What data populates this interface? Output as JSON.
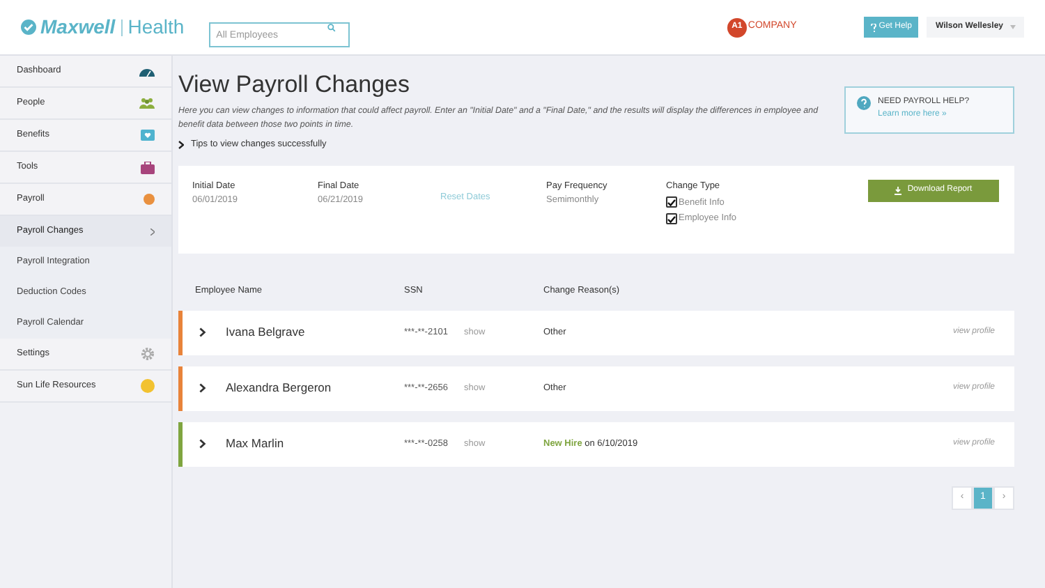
{
  "header": {
    "brand_primary": "Maxwell",
    "brand_secondary": "Health",
    "search": {
      "placeholder": "All Employees"
    },
    "company": {
      "badge": "A1",
      "name": "COMPANY"
    },
    "help_button": "Get Help",
    "user": "Wilson Wellesley"
  },
  "sidebar": {
    "items": [
      {
        "label": "Dashboard"
      },
      {
        "label": "People"
      },
      {
        "label": "Benefits"
      },
      {
        "label": "Tools"
      },
      {
        "label": "Payroll",
        "expanded": true,
        "children": [
          {
            "label": "Payroll Changes",
            "selected": true
          },
          {
            "label": "Payroll Integration",
            "selected": false
          },
          {
            "label": "Deduction Codes",
            "selected": false
          },
          {
            "label": "Payroll Calendar",
            "selected": false
          }
        ]
      },
      {
        "label": "Settings"
      },
      {
        "label": "Sun Life Resources"
      }
    ]
  },
  "page": {
    "title": "View Payroll Changes",
    "intro": "Here you can view changes to information that could affect payroll. Enter an \"Initial Date\" and a \"Final Date,\" and the results will display the differences in employee and benefit data between those two points in time.",
    "tips": "Tips to view changes successfully",
    "help_box": {
      "title": "NEED PAYROLL HELP?",
      "link": "Learn more here »"
    }
  },
  "filters": {
    "initial_date": {
      "label": "Initial Date",
      "value": "06/01/2019"
    },
    "final_date": {
      "label": "Final Date",
      "value": "06/21/2019"
    },
    "reset": "Reset Dates",
    "pay_frequency": {
      "label": "Pay Frequency",
      "value": "Semimonthly"
    },
    "change_type": {
      "label": "Change Type",
      "options": [
        {
          "label": "Benefit Info",
          "checked": true
        },
        {
          "label": "Employee Info",
          "checked": true
        }
      ]
    },
    "download_button": "Download Report"
  },
  "table": {
    "columns": [
      "Employee Name",
      "SSN",
      "Change Reason(s)"
    ],
    "rows": [
      {
        "name": "Ivana Belgrave",
        "ssn": "***-**-2101",
        "show": "show",
        "reason": "Other",
        "link": "view profile",
        "color": "#e8833a"
      },
      {
        "name": "Alexandra Bergeron",
        "ssn": "***-**-2656",
        "show": "show",
        "reason": "Other",
        "link": "view profile",
        "color": "#e8833a"
      },
      {
        "name": "Max Marlin",
        "ssn": "***-**-0258",
        "show": "show",
        "reason_tag": "New Hire",
        "reason": "on 6/10/2019",
        "link": "view profile",
        "color": "#7fa540"
      }
    ]
  },
  "pagination": [
    {
      "label": "‹",
      "selected": false
    },
    {
      "label": "1",
      "selected": true
    },
    {
      "label": "›",
      "selected": false
    }
  ]
}
